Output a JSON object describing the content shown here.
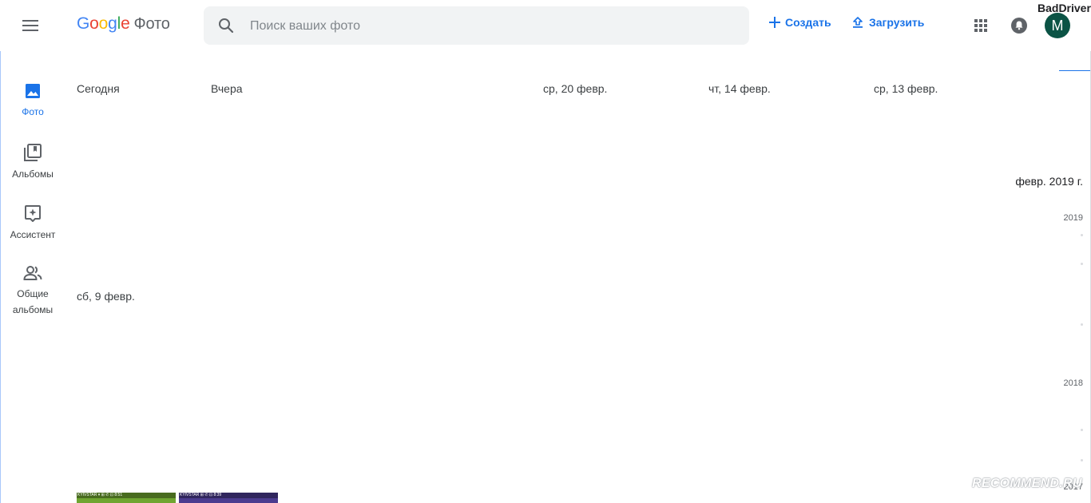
{
  "header": {
    "logo": {
      "part1": "G",
      "part2": "o",
      "part3": "o",
      "part4": "g",
      "part5": "l",
      "part6": "e",
      "product": "Фото"
    },
    "search_placeholder": "Поиск ваших фото",
    "create_label": "Создать",
    "upload_label": "Загрузить",
    "user_name": "BadDriver",
    "avatar_letter": "M",
    "icons": {
      "menu": "menu-icon",
      "search": "search-icon",
      "create": "plus-icon",
      "upload": "upload-icon",
      "apps": "apps-grid-icon",
      "notifications": "bell-icon"
    }
  },
  "nav": {
    "items": [
      {
        "label": "Фото",
        "icon": "photo-icon",
        "active": true
      },
      {
        "label": "Альбомы",
        "icon": "album-icon",
        "active": false
      },
      {
        "label": "Ассистент",
        "icon": "assistant-icon",
        "active": false
      },
      {
        "label_line1": "Общие",
        "label_line2": "альбомы",
        "icon": "people-icon",
        "active": false
      }
    ]
  },
  "main": {
    "dates": [
      "Сегодня",
      "Вчера",
      "ср, 20 февр.",
      "чт, 14 февр.",
      "ср, 13 февр.",
      "сб, 9 февр."
    ],
    "thumbs": [
      {
        "status_text": "KYIVSTAR  ▾ ⊞ ✆ ⊡ 8:51",
        "color": "#6fa531"
      },
      {
        "status_text": "KYIVSTAR  ⊞ ✆ ⊡ 8:39",
        "color": "#4b3b8f"
      }
    ]
  },
  "scrubber": {
    "hover_label": "февр. 2019 г.",
    "years": [
      "2019",
      "2018",
      "2017"
    ]
  },
  "watermark": "RECOMMEND.RU",
  "colors": {
    "accent": "#1a73e8",
    "avatar_bg": "#0b5345"
  }
}
